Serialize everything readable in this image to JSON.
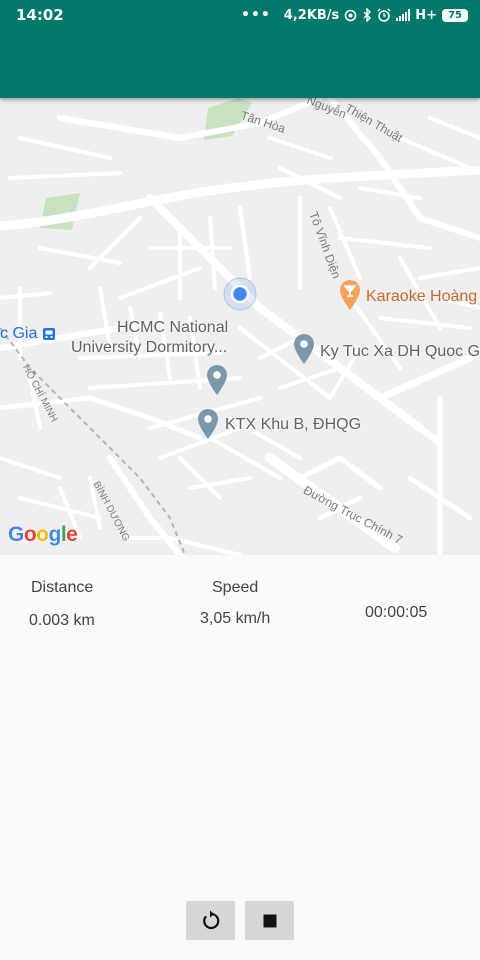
{
  "status_bar": {
    "time": "14:02",
    "dots": "•••",
    "network_speed": "4,2KB/s",
    "network_type": "H+",
    "battery": "75"
  },
  "map": {
    "labels": {
      "tan_hoa": "Tân Hòa",
      "nguyen": "Nguyễn",
      "thien_thuat": "Thiện Thuật",
      "to_vinh_dien": "Tô Vĩnh Diện",
      "karaoke": "Karaoke Hoàng",
      "quoc_gia": "c Gia",
      "dormitory_line1": "HCMC National",
      "dormitory_line2": "University Dormitory...",
      "ky_tuc_xa": "Ky Tuc Xa DH Quoc Gi",
      "ho_chi_minh": "HỒ CHÍ MINH",
      "ktx_khu_b": "KTX Khu B, ĐHQG",
      "binh_duong": "BÌNH DƯƠNG",
      "duong_truc_chinh": "Đường Trục Chính 7"
    },
    "google_logo": [
      "G",
      "o",
      "o",
      "g",
      "l",
      "e"
    ],
    "colors": {
      "location_dot": "#4285f4",
      "pin": "#7a98a8",
      "karaoke_pin": "#f5a35a"
    }
  },
  "stats": {
    "distance_label": "Distance",
    "distance_value": "0.003 km",
    "speed_label": "Speed",
    "speed_value": "3,05 km/h",
    "elapsed_time": "00:00:05"
  },
  "controls": {
    "reset_icon": "refresh-icon",
    "stop_icon": "stop-icon"
  },
  "colors": {
    "app_bar": "#00796b",
    "background": "#fafafa",
    "button": "#d6d6d6"
  }
}
